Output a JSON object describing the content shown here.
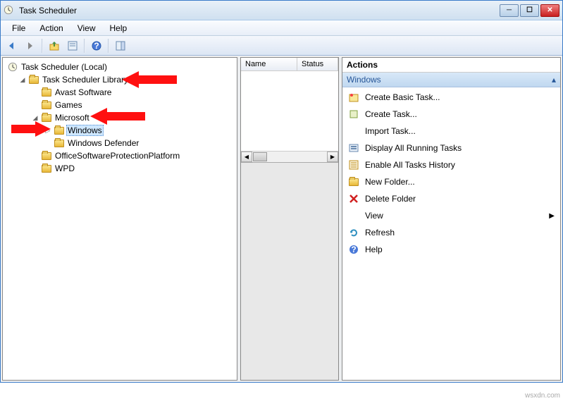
{
  "window": {
    "title": "Task Scheduler"
  },
  "menu": {
    "file": "File",
    "action": "Action",
    "view": "View",
    "help": "Help"
  },
  "tree": {
    "root": "Task Scheduler (Local)",
    "library": "Task Scheduler Library",
    "items": {
      "avast": "Avast Software",
      "games": "Games",
      "microsoft": "Microsoft",
      "windows": "Windows",
      "defender": "Windows Defender",
      "ospp": "OfficeSoftwareProtectionPlatform",
      "wpd": "WPD"
    }
  },
  "list": {
    "columns": {
      "name": "Name",
      "status": "Status"
    }
  },
  "actions": {
    "title": "Actions",
    "section": "Windows",
    "items": {
      "create_basic": "Create Basic Task...",
      "create_task": "Create Task...",
      "import_task": "Import Task...",
      "display_running": "Display All Running Tasks",
      "enable_history": "Enable All Tasks History",
      "new_folder": "New Folder...",
      "delete_folder": "Delete Folder",
      "view": "View",
      "refresh": "Refresh",
      "help": "Help"
    }
  },
  "watermark": "wsxdn.com"
}
